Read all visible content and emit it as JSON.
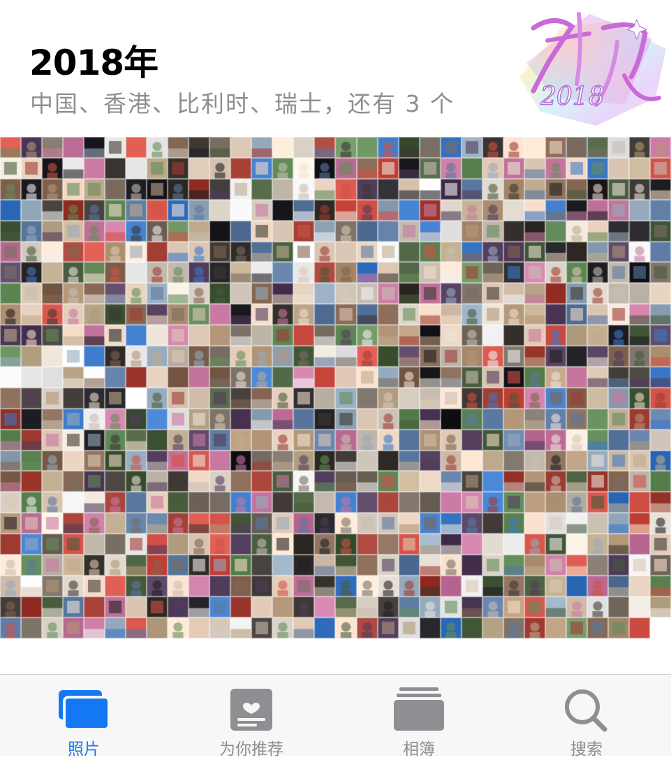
{
  "header": {
    "title": "2018年",
    "subtitle": "中国、香港、比利时、瑞士，还有 3 个"
  },
  "badge": {
    "text_line1": "再见",
    "text_line2": "2018"
  },
  "tabbar": {
    "tabs": [
      {
        "label": "照片",
        "icon": "photos-icon",
        "active": true
      },
      {
        "label": "为你推荐",
        "icon": "for-you-icon",
        "active": false
      },
      {
        "label": "相簿",
        "icon": "albums-icon",
        "active": false
      },
      {
        "label": "搜索",
        "icon": "search-icon",
        "active": false
      }
    ]
  },
  "colors": {
    "accent": "#1478f5",
    "inactive": "#8e8e93",
    "title": "#000000",
    "subtitle": "#8e8e93"
  }
}
